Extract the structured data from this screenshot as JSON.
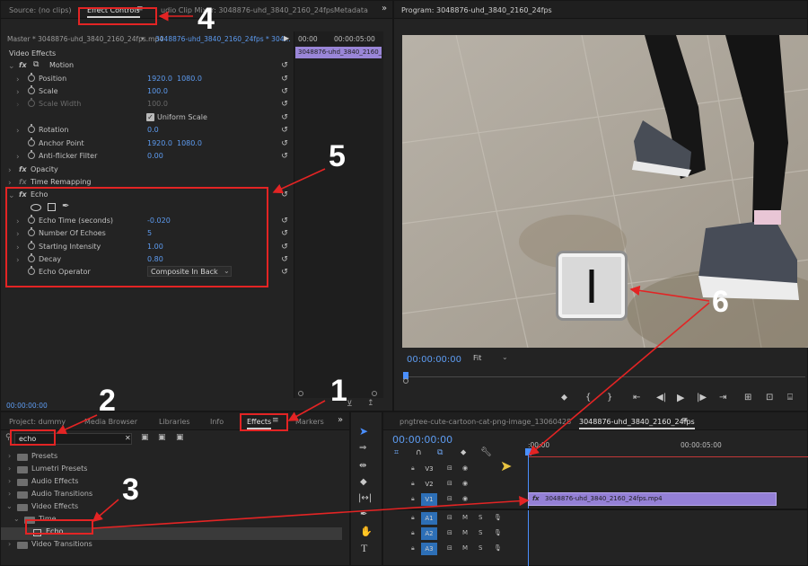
{
  "effect_controls": {
    "tabs": [
      "Source: (no clips)",
      "Effect Controls",
      "udio Clip Mixer: 3048876-uhd_3840_2160_24fps",
      "Metadata"
    ],
    "master_label": "Master * 3048876-uhd_3840_2160_24fps.mp4",
    "sequence_label": "3048876-uhd_3840_2160_24fps * 304...",
    "timecode_start": "00:00",
    "timecode_end": "00:00:05:00",
    "clip_name": "3048876-uhd_3840_2160_2",
    "video_effects_label": "Video Effects",
    "motion": "Motion",
    "position": {
      "label": "Position",
      "x": "1920.0",
      "y": "1080.0"
    },
    "scale": {
      "label": "Scale",
      "value": "100.0"
    },
    "scale_width": {
      "label": "Scale Width",
      "value": "100.0"
    },
    "uniform_scale": "Uniform Scale",
    "rotation": {
      "label": "Rotation",
      "value": "0.0"
    },
    "anchor": {
      "label": "Anchor Point",
      "x": "1920.0",
      "y": "1080.0"
    },
    "antiflicker": {
      "label": "Anti-flicker Filter",
      "value": "0.00"
    },
    "opacity": "Opacity",
    "time_remapping": "Time Remapping",
    "echo": "Echo",
    "echo_time": {
      "label": "Echo Time (seconds)",
      "value": "-0.020"
    },
    "num_echoes": {
      "label": "Number Of Echoes",
      "value": "5"
    },
    "start_intensity": {
      "label": "Starting Intensity",
      "value": "1.00"
    },
    "decay": {
      "label": "Decay",
      "value": "0.80"
    },
    "echo_operator": {
      "label": "Echo Operator",
      "value": "Composite In Back"
    },
    "bottom_timecode": "00:00:00:00"
  },
  "program": {
    "title": "Program: 3048876-uhd_3840_2160_24fps",
    "timecode": "00:00:00:00",
    "fit": "Fit",
    "key_label": "I"
  },
  "project": {
    "tabs": [
      "Project: dummy",
      "Media Browser",
      "Libraries",
      "Info",
      "Effects",
      "Markers"
    ],
    "search_value": "echo",
    "tree": [
      "Presets",
      "Lumetri Presets",
      "Audio Effects",
      "Audio Transitions",
      "Video Effects",
      "Time",
      "Echo",
      "Video Transitions"
    ]
  },
  "timeline": {
    "tabs": [
      "pngtree-cute-cartoon-cat-png-image_13060428",
      "3048876-uhd_3840_2160_24fps"
    ],
    "timecode": "00:00:00:00",
    "ruler": [
      ":00:00",
      "00:00:05:00"
    ],
    "tracks": [
      "V3",
      "V2",
      "V1",
      "A1",
      "A2",
      "A3"
    ],
    "track_letters": [
      "M",
      "S"
    ],
    "clip_label": "3048876-uhd_3840_2160_24fps.mp4"
  },
  "callouts": [
    "1",
    "2",
    "3",
    "4",
    "5",
    "6"
  ],
  "colors": {
    "accent": "#5d9bf0",
    "red": "#e32424",
    "clip": "#8a7ad0",
    "playhead": "#4a8fff"
  }
}
